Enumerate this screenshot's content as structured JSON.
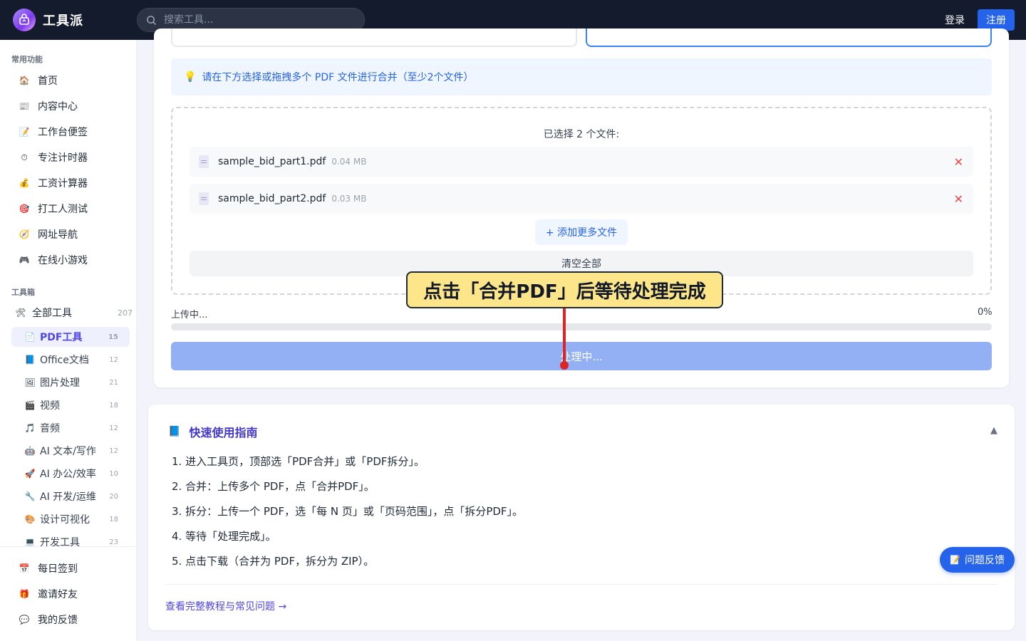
{
  "header": {
    "logo_text": "工具派",
    "search_placeholder": "搜索工具...",
    "login": "登录",
    "register": "注册"
  },
  "sidebar": {
    "common_title": "常用功能",
    "common_items": [
      {
        "label": "首页",
        "icon": "🏠"
      },
      {
        "label": "内容中心",
        "icon": "📰"
      },
      {
        "label": "工作台便签",
        "icon": "📝"
      },
      {
        "label": "专注计时器",
        "icon": "⏱"
      },
      {
        "label": "工资计算器",
        "icon": "💰"
      },
      {
        "label": "打工人测试",
        "icon": "🎯"
      },
      {
        "label": "网址导航",
        "icon": "🧭"
      },
      {
        "label": "在线小游戏",
        "icon": "🎮"
      }
    ],
    "toolbox_title": "工具箱",
    "all_tools": {
      "label": "全部工具",
      "count": "207",
      "icon": "🛠"
    },
    "tool_categories": [
      {
        "label": "PDF工具",
        "count": "15",
        "icon": "📄"
      },
      {
        "label": "Office文档",
        "count": "12",
        "icon": "📘"
      },
      {
        "label": "图片处理",
        "count": "21",
        "icon": "🖼"
      },
      {
        "label": "视频",
        "count": "18",
        "icon": "🎬"
      },
      {
        "label": "音频",
        "count": "12",
        "icon": "🎵"
      },
      {
        "label": "AI 文本/写作",
        "count": "12",
        "icon": "🤖"
      },
      {
        "label": "AI 办公/效率",
        "count": "10",
        "icon": "🚀"
      },
      {
        "label": "AI 开发/运维",
        "count": "20",
        "icon": "🔧"
      },
      {
        "label": "设计可视化",
        "count": "18",
        "icon": "🎨"
      },
      {
        "label": "开发工具",
        "count": "23",
        "icon": "💻"
      }
    ],
    "bottom_items": [
      {
        "label": "每日签到",
        "icon": "📅"
      },
      {
        "label": "邀请好友",
        "icon": "🎁"
      },
      {
        "label": "我的反馈",
        "icon": "💬"
      }
    ]
  },
  "merge": {
    "hint": "请在下方选择或拖拽多个 PDF 文件进行合并（至少2个文件）",
    "hint_icon": "💡",
    "selected_text": "已选择 2 个文件:",
    "files": [
      {
        "name": "sample_bid_part1.pdf",
        "size": "0.04 MB"
      },
      {
        "name": "sample_bid_part2.pdf",
        "size": "0.03 MB"
      }
    ],
    "remove_icon": "✕",
    "add_more": "+ 添加更多文件",
    "clear_all": "清空全部",
    "upload_label": "上传中...",
    "upload_percent": "0%",
    "progress_value": 0,
    "process_button": "处理中..."
  },
  "annotation": {
    "callout": "点击「合并PDF」后等待处理完成"
  },
  "guide": {
    "title": "快速使用指南",
    "title_icon": "📘",
    "collapse_icon": "▲",
    "steps": [
      "1. 进入工具页，顶部选「PDF合并」或「PDF拆分」。",
      "2. 合并：上传多个 PDF，点「合并PDF」。",
      "3. 拆分：上传一个 PDF，选「每 N 页」或「页码范围」，点「拆分PDF」。",
      "4. 等待「处理完成」。",
      "5. 点击下载（合并为 PDF，拆分为 ZIP）。"
    ],
    "link": "查看完整教程与常见问题 →"
  },
  "feedback": {
    "label": "问题反馈",
    "icon": "📝"
  },
  "colors": {
    "accent": "#2563eb",
    "topbar": "#141b2d",
    "active_nav": "#4f46e5",
    "callout_bg": "#fde68a",
    "pointer": "#dc2626"
  }
}
